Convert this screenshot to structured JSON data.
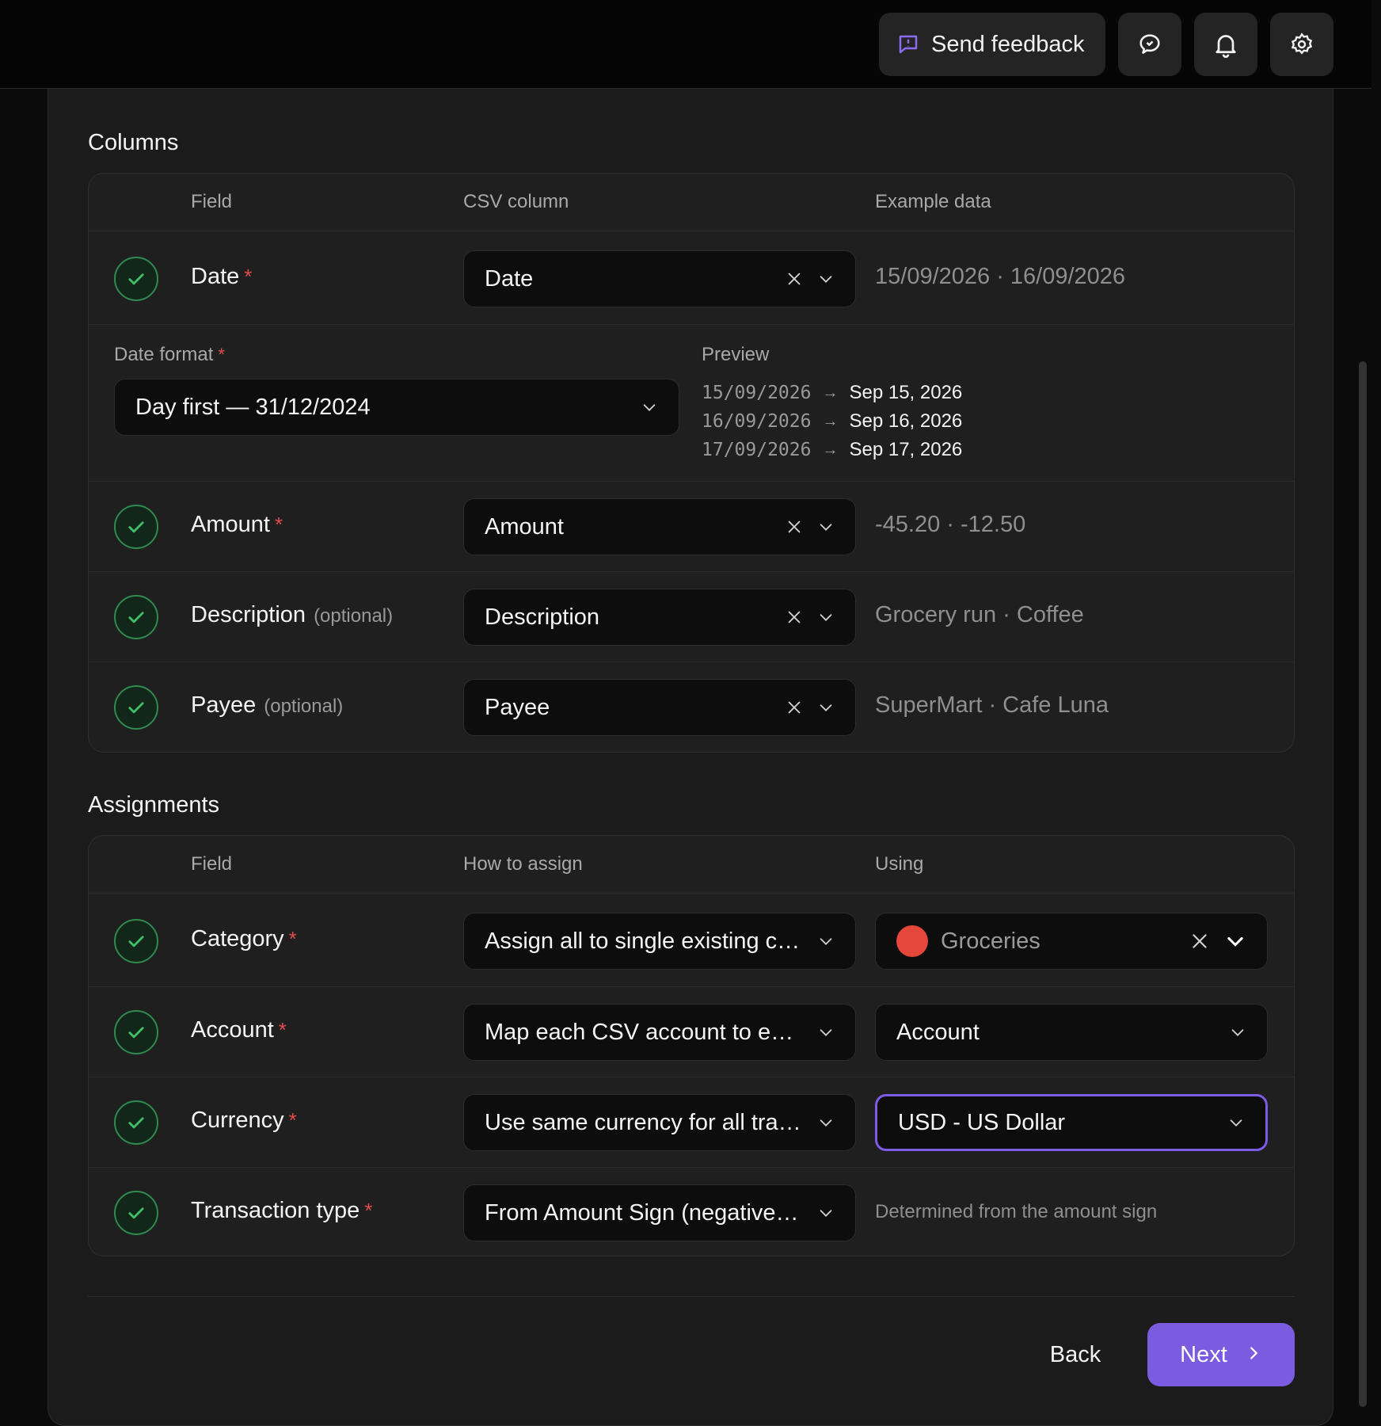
{
  "topbar": {
    "feedback_label": "Send feedback"
  },
  "columns": {
    "title": "Columns",
    "headers": {
      "field": "Field",
      "csv_column": "CSV column",
      "example": "Example data"
    },
    "date": {
      "label": "Date",
      "value": "Date",
      "example": "15/09/2026 · 16/09/2026"
    },
    "date_format": {
      "label": "Date format",
      "value": "Day first — 31/12/2024",
      "preview_label": "Preview",
      "preview": [
        {
          "raw": "15/09/2026",
          "out": "Sep 15, 2026"
        },
        {
          "raw": "16/09/2026",
          "out": "Sep 16, 2026"
        },
        {
          "raw": "17/09/2026",
          "out": "Sep 17, 2026"
        }
      ]
    },
    "amount": {
      "label": "Amount",
      "value": "Amount",
      "example": "-45.20 · -12.50"
    },
    "description": {
      "label": "Description",
      "optional": "(optional)",
      "value": "Description",
      "example": "Grocery run · Coffee"
    },
    "payee": {
      "label": "Payee",
      "optional": "(optional)",
      "value": "Payee",
      "example": "SuperMart · Cafe Luna"
    }
  },
  "assignments": {
    "title": "Assignments",
    "headers": {
      "field": "Field",
      "how": "How to assign",
      "using": "Using"
    },
    "category": {
      "label": "Category",
      "how": "Assign all to single existing category",
      "using": "Groceries",
      "dot_color": "#e5473c"
    },
    "account": {
      "label": "Account",
      "how": "Map each CSV account to existing account",
      "using": "Account"
    },
    "currency": {
      "label": "Currency",
      "how": "Use same currency for all transactions",
      "using": "USD - US Dollar"
    },
    "transaction_type": {
      "label": "Transaction type",
      "how": "From Amount Sign (negative = expense)",
      "using": "Determined from the amount sign"
    }
  },
  "required_mark": "*",
  "footer": {
    "back_label": "Back",
    "next_label": "Next"
  },
  "colors": {
    "accent": "#7b5ce0",
    "check": "#2f8a4e",
    "required": "#e04b4b"
  }
}
